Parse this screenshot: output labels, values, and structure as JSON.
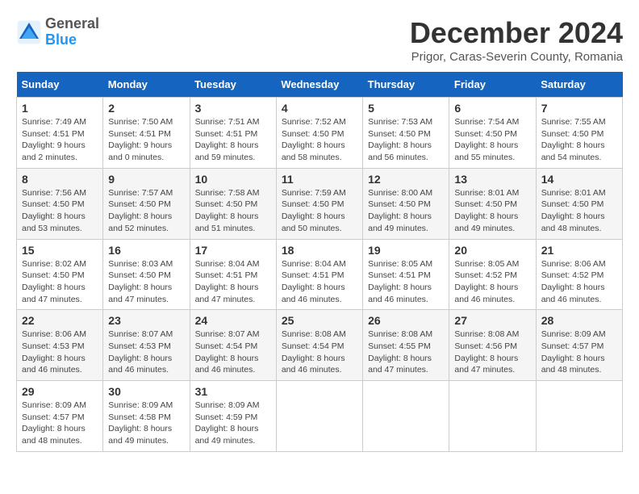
{
  "header": {
    "logo_line1": "General",
    "logo_line2": "Blue",
    "title": "December 2024",
    "subtitle": "Prigor, Caras-Severin County, Romania"
  },
  "columns": [
    "Sunday",
    "Monday",
    "Tuesday",
    "Wednesday",
    "Thursday",
    "Friday",
    "Saturday"
  ],
  "weeks": [
    [
      {
        "day": "1",
        "sunrise": "Sunrise: 7:49 AM",
        "sunset": "Sunset: 4:51 PM",
        "daylight": "Daylight: 9 hours and 2 minutes."
      },
      {
        "day": "2",
        "sunrise": "Sunrise: 7:50 AM",
        "sunset": "Sunset: 4:51 PM",
        "daylight": "Daylight: 9 hours and 0 minutes."
      },
      {
        "day": "3",
        "sunrise": "Sunrise: 7:51 AM",
        "sunset": "Sunset: 4:51 PM",
        "daylight": "Daylight: 8 hours and 59 minutes."
      },
      {
        "day": "4",
        "sunrise": "Sunrise: 7:52 AM",
        "sunset": "Sunset: 4:50 PM",
        "daylight": "Daylight: 8 hours and 58 minutes."
      },
      {
        "day": "5",
        "sunrise": "Sunrise: 7:53 AM",
        "sunset": "Sunset: 4:50 PM",
        "daylight": "Daylight: 8 hours and 56 minutes."
      },
      {
        "day": "6",
        "sunrise": "Sunrise: 7:54 AM",
        "sunset": "Sunset: 4:50 PM",
        "daylight": "Daylight: 8 hours and 55 minutes."
      },
      {
        "day": "7",
        "sunrise": "Sunrise: 7:55 AM",
        "sunset": "Sunset: 4:50 PM",
        "daylight": "Daylight: 8 hours and 54 minutes."
      }
    ],
    [
      {
        "day": "8",
        "sunrise": "Sunrise: 7:56 AM",
        "sunset": "Sunset: 4:50 PM",
        "daylight": "Daylight: 8 hours and 53 minutes."
      },
      {
        "day": "9",
        "sunrise": "Sunrise: 7:57 AM",
        "sunset": "Sunset: 4:50 PM",
        "daylight": "Daylight: 8 hours and 52 minutes."
      },
      {
        "day": "10",
        "sunrise": "Sunrise: 7:58 AM",
        "sunset": "Sunset: 4:50 PM",
        "daylight": "Daylight: 8 hours and 51 minutes."
      },
      {
        "day": "11",
        "sunrise": "Sunrise: 7:59 AM",
        "sunset": "Sunset: 4:50 PM",
        "daylight": "Daylight: 8 hours and 50 minutes."
      },
      {
        "day": "12",
        "sunrise": "Sunrise: 8:00 AM",
        "sunset": "Sunset: 4:50 PM",
        "daylight": "Daylight: 8 hours and 49 minutes."
      },
      {
        "day": "13",
        "sunrise": "Sunrise: 8:01 AM",
        "sunset": "Sunset: 4:50 PM",
        "daylight": "Daylight: 8 hours and 49 minutes."
      },
      {
        "day": "14",
        "sunrise": "Sunrise: 8:01 AM",
        "sunset": "Sunset: 4:50 PM",
        "daylight": "Daylight: 8 hours and 48 minutes."
      }
    ],
    [
      {
        "day": "15",
        "sunrise": "Sunrise: 8:02 AM",
        "sunset": "Sunset: 4:50 PM",
        "daylight": "Daylight: 8 hours and 47 minutes."
      },
      {
        "day": "16",
        "sunrise": "Sunrise: 8:03 AM",
        "sunset": "Sunset: 4:50 PM",
        "daylight": "Daylight: 8 hours and 47 minutes."
      },
      {
        "day": "17",
        "sunrise": "Sunrise: 8:04 AM",
        "sunset": "Sunset: 4:51 PM",
        "daylight": "Daylight: 8 hours and 47 minutes."
      },
      {
        "day": "18",
        "sunrise": "Sunrise: 8:04 AM",
        "sunset": "Sunset: 4:51 PM",
        "daylight": "Daylight: 8 hours and 46 minutes."
      },
      {
        "day": "19",
        "sunrise": "Sunrise: 8:05 AM",
        "sunset": "Sunset: 4:51 PM",
        "daylight": "Daylight: 8 hours and 46 minutes."
      },
      {
        "day": "20",
        "sunrise": "Sunrise: 8:05 AM",
        "sunset": "Sunset: 4:52 PM",
        "daylight": "Daylight: 8 hours and 46 minutes."
      },
      {
        "day": "21",
        "sunrise": "Sunrise: 8:06 AM",
        "sunset": "Sunset: 4:52 PM",
        "daylight": "Daylight: 8 hours and 46 minutes."
      }
    ],
    [
      {
        "day": "22",
        "sunrise": "Sunrise: 8:06 AM",
        "sunset": "Sunset: 4:53 PM",
        "daylight": "Daylight: 8 hours and 46 minutes."
      },
      {
        "day": "23",
        "sunrise": "Sunrise: 8:07 AM",
        "sunset": "Sunset: 4:53 PM",
        "daylight": "Daylight: 8 hours and 46 minutes."
      },
      {
        "day": "24",
        "sunrise": "Sunrise: 8:07 AM",
        "sunset": "Sunset: 4:54 PM",
        "daylight": "Daylight: 8 hours and 46 minutes."
      },
      {
        "day": "25",
        "sunrise": "Sunrise: 8:08 AM",
        "sunset": "Sunset: 4:54 PM",
        "daylight": "Daylight: 8 hours and 46 minutes."
      },
      {
        "day": "26",
        "sunrise": "Sunrise: 8:08 AM",
        "sunset": "Sunset: 4:55 PM",
        "daylight": "Daylight: 8 hours and 47 minutes."
      },
      {
        "day": "27",
        "sunrise": "Sunrise: 8:08 AM",
        "sunset": "Sunset: 4:56 PM",
        "daylight": "Daylight: 8 hours and 47 minutes."
      },
      {
        "day": "28",
        "sunrise": "Sunrise: 8:09 AM",
        "sunset": "Sunset: 4:57 PM",
        "daylight": "Daylight: 8 hours and 48 minutes."
      }
    ],
    [
      {
        "day": "29",
        "sunrise": "Sunrise: 8:09 AM",
        "sunset": "Sunset: 4:57 PM",
        "daylight": "Daylight: 8 hours and 48 minutes."
      },
      {
        "day": "30",
        "sunrise": "Sunrise: 8:09 AM",
        "sunset": "Sunset: 4:58 PM",
        "daylight": "Daylight: 8 hours and 49 minutes."
      },
      {
        "day": "31",
        "sunrise": "Sunrise: 8:09 AM",
        "sunset": "Sunset: 4:59 PM",
        "daylight": "Daylight: 8 hours and 49 minutes."
      },
      null,
      null,
      null,
      null
    ]
  ]
}
